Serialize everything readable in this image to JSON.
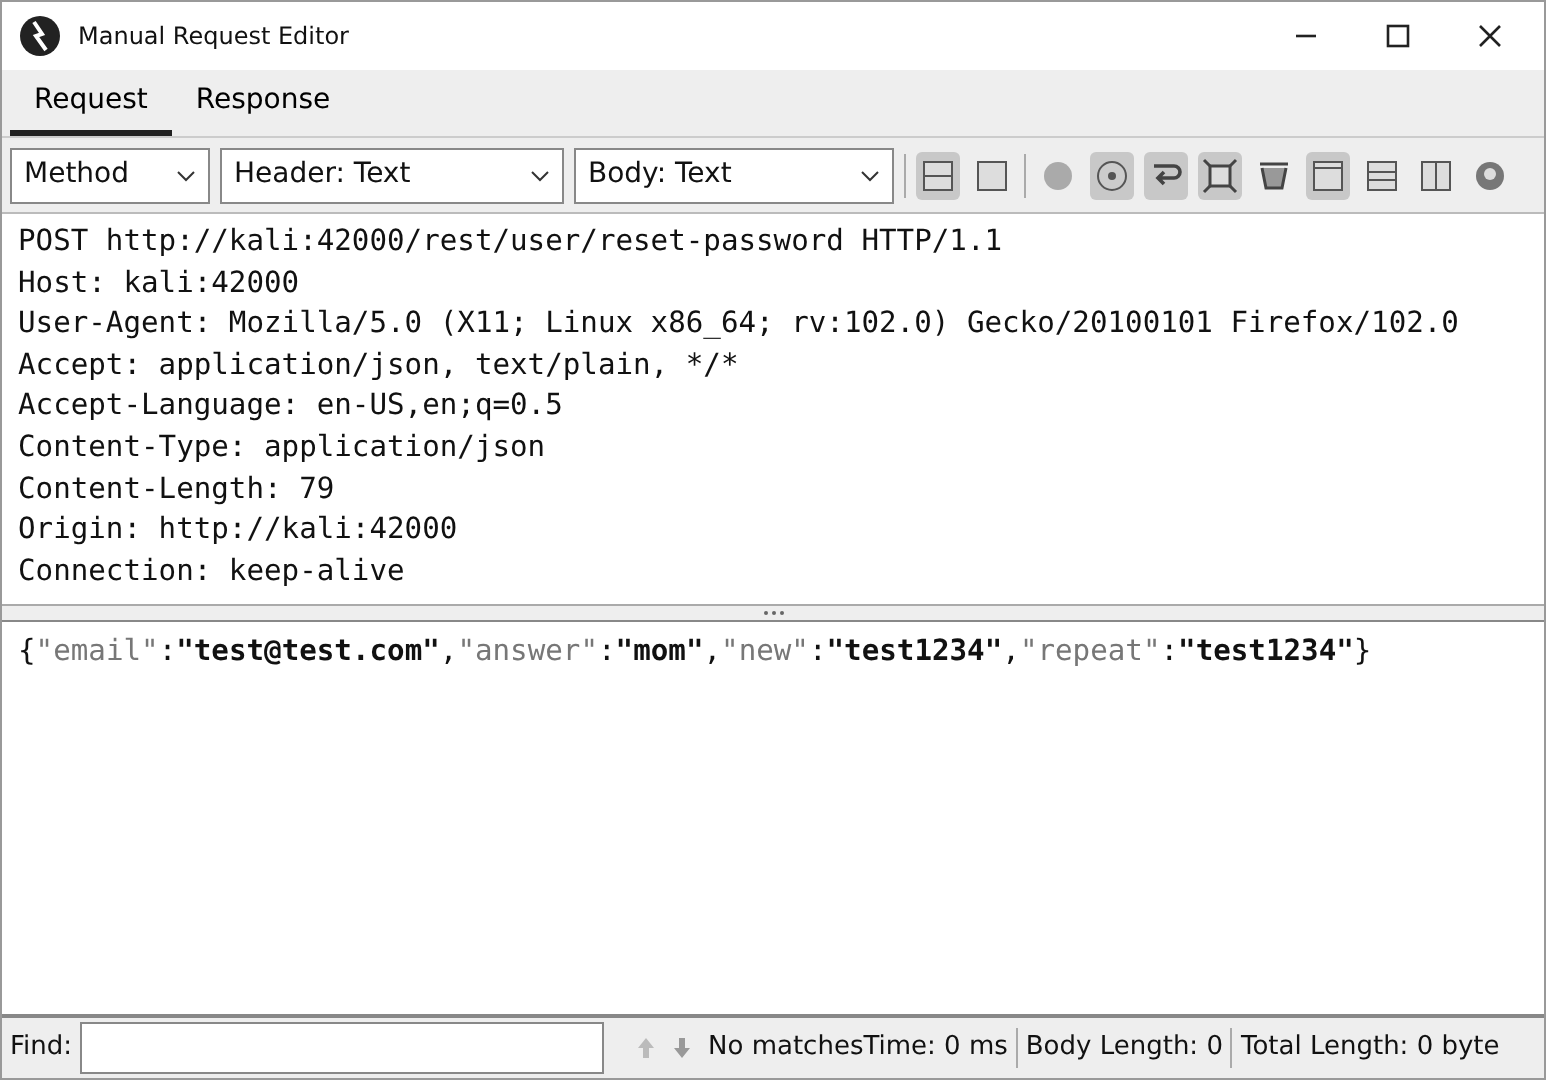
{
  "window": {
    "title": "Manual Request Editor"
  },
  "tabs": [
    {
      "label": "Request",
      "selected": true
    },
    {
      "label": "Response",
      "selected": false
    }
  ],
  "toolbar": {
    "selects": [
      {
        "value": "Method"
      },
      {
        "value": "Header: Text"
      },
      {
        "value": "Body: Text"
      }
    ],
    "icons": [
      {
        "kind": "split-horizontal",
        "pressed": true
      },
      {
        "kind": "single-panel",
        "pressed": false
      },
      {
        "kind": "separator"
      },
      {
        "kind": "dot",
        "pressed": false
      },
      {
        "kind": "target",
        "pressed": true
      },
      {
        "kind": "wrap",
        "pressed": true
      },
      {
        "kind": "expand",
        "pressed": true
      },
      {
        "kind": "bucket",
        "pressed": false
      },
      {
        "kind": "window",
        "pressed": true
      },
      {
        "kind": "rows",
        "pressed": false
      },
      {
        "kind": "columns",
        "pressed": false
      },
      {
        "kind": "help",
        "pressed": false
      }
    ]
  },
  "header_lines": [
    "POST http://kali:42000/rest/user/reset-password HTTP/1.1",
    "Host: kali:42000",
    "User-Agent: Mozilla/5.0 (X11; Linux x86_64; rv:102.0) Gecko/20100101 Firefox/102.0",
    "Accept: application/json, text/plain, */*",
    "Accept-Language: en-US,en;q=0.5",
    "Content-Type: application/json",
    "Content-Length: 79",
    "Origin: http://kali:42000",
    "Connection: keep-alive"
  ],
  "body_tokens": [
    {
      "text": "{",
      "kind": "punct"
    },
    {
      "text": "\"email\"",
      "kind": "key"
    },
    {
      "text": ":",
      "kind": "punct"
    },
    {
      "text": "\"test@test.com\"",
      "kind": "value"
    },
    {
      "text": ",",
      "kind": "punct"
    },
    {
      "text": "\"answer\"",
      "kind": "key"
    },
    {
      "text": ":",
      "kind": "punct"
    },
    {
      "text": "\"mom\"",
      "kind": "value"
    },
    {
      "text": ",",
      "kind": "punct"
    },
    {
      "text": "\"new\"",
      "kind": "key"
    },
    {
      "text": ":",
      "kind": "punct"
    },
    {
      "text": "\"test1234\"",
      "kind": "value"
    },
    {
      "text": ",",
      "kind": "punct"
    },
    {
      "text": "\"repeat\"",
      "kind": "key"
    },
    {
      "text": ":",
      "kind": "punct"
    },
    {
      "text": "\"test1234\"",
      "kind": "value"
    },
    {
      "text": "}",
      "kind": "punct"
    }
  ],
  "status_bar": {
    "find_label": "Find:",
    "matches": "No matches",
    "time": "Time: 0 ms",
    "body_length": "Body Length: 0",
    "total_length": "Total Length: 0 byte"
  }
}
